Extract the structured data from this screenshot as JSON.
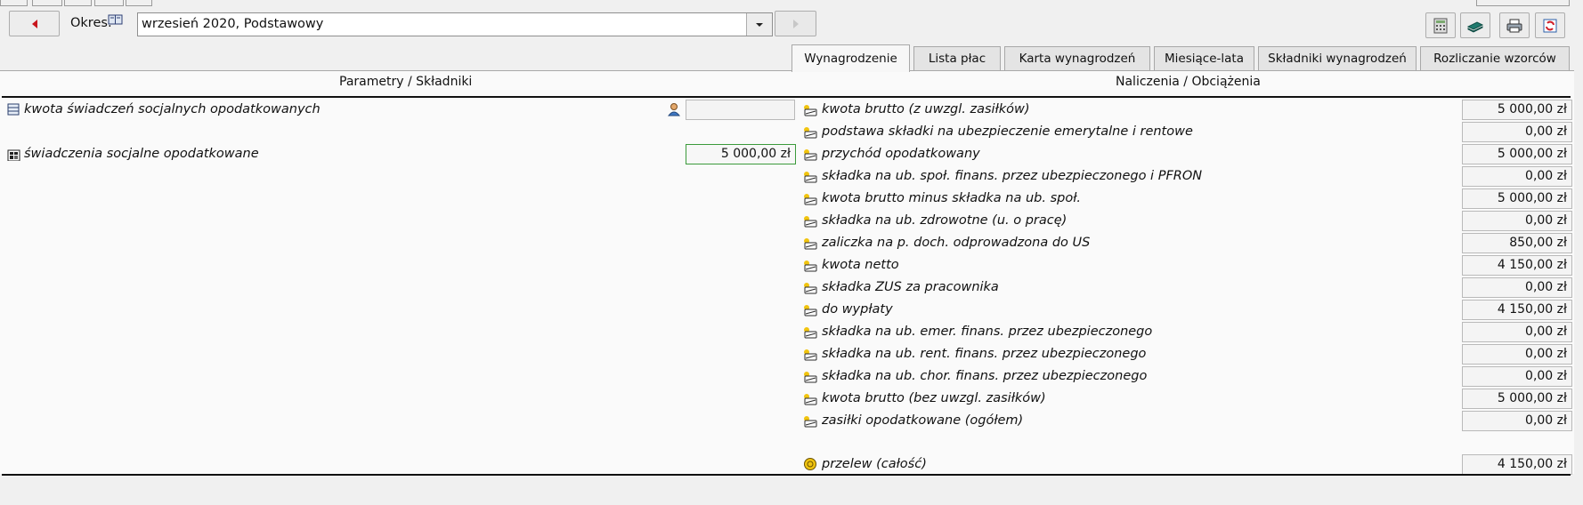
{
  "period": {
    "label": "Okres:",
    "value": "wrzesień 2020, Podstawowy"
  },
  "tabs": [
    {
      "label": "Wynagrodzenie",
      "active": true
    },
    {
      "label": "Lista płac",
      "active": false
    },
    {
      "label": "Karta wynagrodzeń",
      "active": false
    },
    {
      "label": "Miesiące-lata",
      "active": false
    },
    {
      "label": "Składniki wynagrodzeń",
      "active": false
    },
    {
      "label": "Rozliczanie wzorców",
      "active": false
    }
  ],
  "left_panel": {
    "header": "Parametry / Składniki",
    "rows": [
      {
        "label": "kwota świadczeń socjalnych opodatkowanych",
        "value": "",
        "icon": "table-icon"
      },
      {
        "label": "świadczenia socjalne opodatkowane",
        "value": "5 000,00 zł",
        "icon": "calculator-icon"
      }
    ]
  },
  "right_panel": {
    "header": "Naliczenia / Obciążenia",
    "rows": [
      {
        "label": "kwota brutto (z uwzgl. zasiłków)",
        "value": "5 000,00 zł"
      },
      {
        "label": "podstawa składki na ubezpieczenie emerytalne i rentowe",
        "value": "0,00 zł"
      },
      {
        "label": "przychód opodatkowany",
        "value": "5 000,00 zł"
      },
      {
        "label": "składka na ub. społ. finans. przez ubezpieczonego i PFRON",
        "value": "0,00 zł"
      },
      {
        "label": "kwota brutto minus składka na ub. społ.",
        "value": "5 000,00 zł"
      },
      {
        "label": "składka na ub. zdrowotne (u. o pracę)",
        "value": "0,00 zł"
      },
      {
        "label": "zaliczka na p. doch. odprowadzona do US",
        "value": "850,00 zł"
      },
      {
        "label": "kwota netto",
        "value": "4 150,00 zł"
      },
      {
        "label": "składka ZUS za pracownika",
        "value": "0,00 zł"
      },
      {
        "label": "do wypłaty",
        "value": "4 150,00 zł"
      },
      {
        "label": "składka na ub. emer. finans. przez ubezpieczonego",
        "value": "0,00 zł"
      },
      {
        "label": "składka na ub. rent. finans. przez ubezpieczonego",
        "value": "0,00 zł"
      },
      {
        "label": "składka na ub. chor. finans. przez ubezpieczonego",
        "value": "0,00 zł"
      },
      {
        "label": "kwota brutto (bez uwzgl. zasiłków)",
        "value": "5 000,00 zł"
      },
      {
        "label": "zasiłki opodatkowane (ogółem)",
        "value": "0,00 zł"
      }
    ],
    "transfer": {
      "label": "przelew (całość)",
      "value": "4 150,00 zł"
    }
  },
  "colors": {
    "accent_border": "#3b9a3b",
    "icon_yellow": "#f1c40f"
  }
}
